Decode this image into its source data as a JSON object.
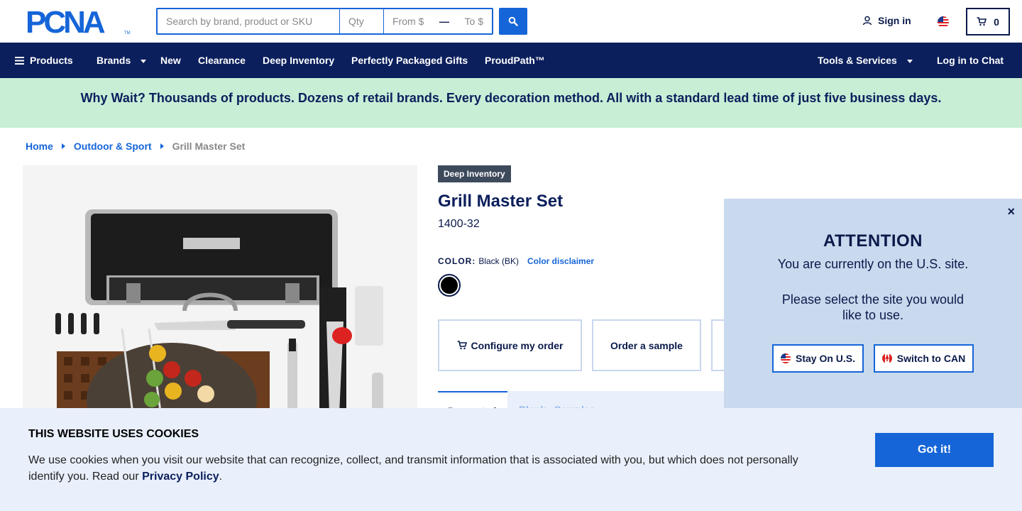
{
  "header": {
    "logo_text": "PCNA",
    "search": {
      "placeholder": "Search by brand, product or SKU",
      "qty_placeholder": "Qty",
      "from_placeholder": "From $",
      "to_placeholder": "To $"
    },
    "sign_in_label": "Sign in",
    "cart_count": "0"
  },
  "nav": {
    "items": [
      {
        "label": "Products"
      },
      {
        "label": "Brands"
      },
      {
        "label": "New"
      },
      {
        "label": "Clearance"
      },
      {
        "label": "Deep Inventory"
      },
      {
        "label": "Perfectly Packaged Gifts"
      },
      {
        "label": "ProudPath™"
      },
      {
        "label": "Tools & Services"
      },
      {
        "label": "Log in to Chat"
      }
    ]
  },
  "promo": {
    "text": "Why Wait? Thousands of products. Dozens of retail brands. Every decoration method. All with a standard lead time of just five business days."
  },
  "breadcrumb": {
    "items": [
      {
        "label": "Home"
      },
      {
        "label": "Outdoor & Sport"
      },
      {
        "label": "Grill Master Set"
      }
    ]
  },
  "product": {
    "badge": "Deep Inventory",
    "title": "Grill Master Set",
    "sku": "1400-32",
    "color_label": "COLOR:",
    "color_value": "Black (BK)",
    "color_disclaimer": "Color disclaimer",
    "swatch_color": "#000000",
    "actions": [
      {
        "label": "Configure my order"
      },
      {
        "label": "Order a sample"
      }
    ],
    "tabs": [
      {
        "label": "Decorated"
      },
      {
        "label": "Blank"
      },
      {
        "label": "Samples"
      }
    ]
  },
  "attention": {
    "close": "×",
    "title": "ATTENTION",
    "line1": "You are currently on the U.S. site.",
    "line2": "Please select the site you would like to use.",
    "stay_label": "Stay On U.S.",
    "switch_label": "Switch to CAN"
  },
  "cookie": {
    "title": "THIS WEBSITE USES COOKIES",
    "text": "We use cookies when you visit our website that can recognize, collect, and transmit information that is associated with you, but which does not personally identify you. Read our",
    "link": "Privacy Policy",
    "period": ".",
    "button": "Got it!"
  },
  "colors": {
    "navy": "#0b1f5c",
    "blue": "#1565d8",
    "mint": "#c8eed6",
    "cookie_bg": "#e9f0fb",
    "modal_bg": "#c9d9ee"
  }
}
